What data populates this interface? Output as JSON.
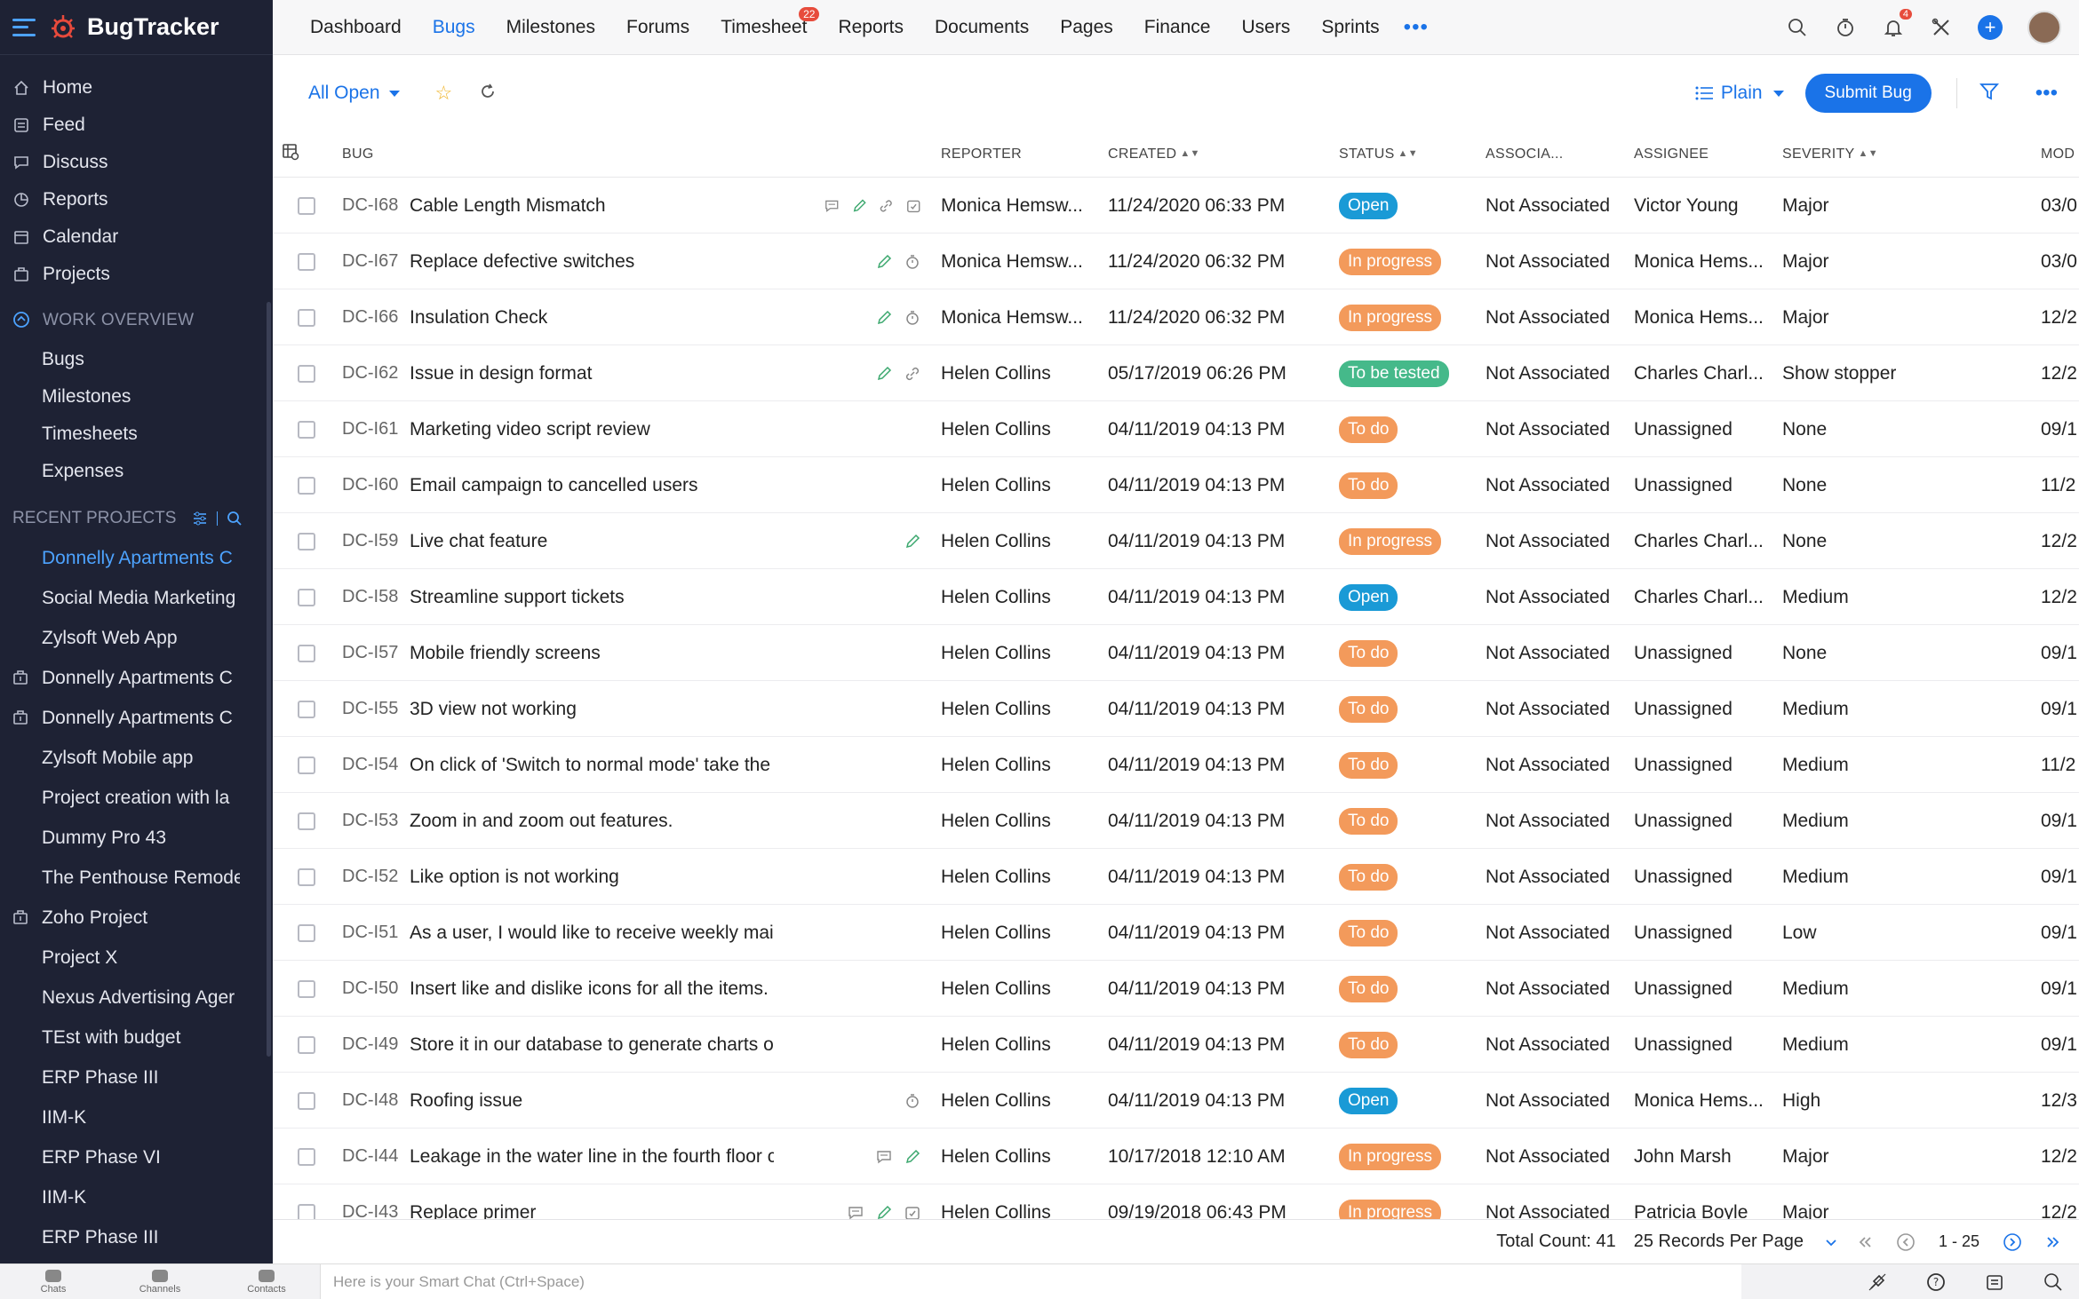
{
  "app": {
    "name": "BugTracker"
  },
  "sidebar": {
    "nav": [
      {
        "label": "Home",
        "icon": "home-icon"
      },
      {
        "label": "Feed",
        "icon": "feed-icon"
      },
      {
        "label": "Discuss",
        "icon": "discuss-icon"
      },
      {
        "label": "Reports",
        "icon": "reports-icon"
      },
      {
        "label": "Calendar",
        "icon": "calendar-icon"
      },
      {
        "label": "Projects",
        "icon": "projects-icon"
      }
    ],
    "work_overview": {
      "title": "WORK OVERVIEW",
      "items": [
        "Bugs",
        "Milestones",
        "Timesheets",
        "Expenses"
      ]
    },
    "recent_projects": {
      "title": "RECENT PROJECTS",
      "items": [
        {
          "label": "Donnelly Apartments C",
          "active": true,
          "icon": false
        },
        {
          "label": "Social Media Marketing",
          "active": false,
          "icon": false
        },
        {
          "label": "Zylsoft Web App",
          "active": false,
          "icon": false
        },
        {
          "label": "Donnelly Apartments C",
          "active": false,
          "icon": true
        },
        {
          "label": "Donnelly Apartments C",
          "active": false,
          "icon": true
        },
        {
          "label": "Zylsoft Mobile app",
          "active": false,
          "icon": false
        },
        {
          "label": "Project creation with la",
          "active": false,
          "icon": false
        },
        {
          "label": "Dummy Pro 43",
          "active": false,
          "icon": false
        },
        {
          "label": "The Penthouse Remode",
          "active": false,
          "icon": false
        },
        {
          "label": "Zoho Project",
          "active": false,
          "icon": true
        },
        {
          "label": "Project X",
          "active": false,
          "icon": false
        },
        {
          "label": "Nexus Advertising Ager",
          "active": false,
          "icon": false
        },
        {
          "label": "TEst with budget",
          "active": false,
          "icon": false
        },
        {
          "label": "ERP Phase III",
          "active": false,
          "icon": false
        },
        {
          "label": "IIM-K",
          "active": false,
          "icon": false
        },
        {
          "label": "ERP Phase VI",
          "active": false,
          "icon": false
        },
        {
          "label": "IIM-K",
          "active": false,
          "icon": false
        },
        {
          "label": "ERP Phase III",
          "active": false,
          "icon": false
        }
      ]
    }
  },
  "topnav": {
    "tabs": [
      {
        "label": "Dashboard",
        "active": false
      },
      {
        "label": "Bugs",
        "active": true
      },
      {
        "label": "Milestones",
        "active": false
      },
      {
        "label": "Forums",
        "active": false
      },
      {
        "label": "Timesheet",
        "active": false,
        "badge": "22"
      },
      {
        "label": "Reports",
        "active": false
      },
      {
        "label": "Documents",
        "active": false
      },
      {
        "label": "Pages",
        "active": false
      },
      {
        "label": "Finance",
        "active": false
      },
      {
        "label": "Users",
        "active": false
      },
      {
        "label": "Sprints",
        "active": false
      }
    ],
    "more": "•••",
    "notification_count": "4"
  },
  "toolbar": {
    "view": "All Open",
    "layout": "Plain",
    "submit_label": "Submit Bug"
  },
  "table": {
    "headers": {
      "bug": "BUG",
      "reporter": "REPORTER",
      "created": "CREATED",
      "status": "STATUS",
      "associated": "ASSOCIA...",
      "assignee": "ASSIGNEE",
      "severity": "SEVERITY",
      "modified": "MOD"
    },
    "rows": [
      {
        "id": "DC-I68",
        "title": "Cable Length Mismatch",
        "icons": [
          "comment-icon",
          "edit-icon",
          "link-icon",
          "task-icon"
        ],
        "reporter": "Monica Hemsw...",
        "created": "11/24/2020 06:33 PM",
        "status": "Open",
        "status_type": "open",
        "associated": "Not Associated",
        "assignee": "Victor Young",
        "severity": "Major",
        "modified": "03/0"
      },
      {
        "id": "DC-I67",
        "title": "Replace defective switches",
        "icons": [
          "edit-icon",
          "timer-icon"
        ],
        "reporter": "Monica Hemsw...",
        "created": "11/24/2020 06:32 PM",
        "status": "In progress",
        "status_type": "progress",
        "associated": "Not Associated",
        "assignee": "Monica Hems...",
        "severity": "Major",
        "modified": "03/0"
      },
      {
        "id": "DC-I66",
        "title": "Insulation Check",
        "icons": [
          "edit-icon",
          "timer-icon"
        ],
        "reporter": "Monica Hemsw...",
        "created": "11/24/2020 06:32 PM",
        "status": "In progress",
        "status_type": "progress",
        "associated": "Not Associated",
        "assignee": "Monica Hems...",
        "severity": "Major",
        "modified": "12/2"
      },
      {
        "id": "DC-I62",
        "title": "Issue in design format",
        "icons": [
          "edit-icon",
          "link-icon"
        ],
        "reporter": "Helen Collins",
        "created": "05/17/2019 06:26 PM",
        "status": "To be tested",
        "status_type": "tested",
        "associated": "Not Associated",
        "assignee": "Charles Charl...",
        "severity": "Show stopper",
        "modified": "12/2"
      },
      {
        "id": "DC-I61",
        "title": "Marketing video script review",
        "icons": [],
        "reporter": "Helen Collins",
        "created": "04/11/2019 04:13 PM",
        "status": "To do",
        "status_type": "todo",
        "associated": "Not Associated",
        "assignee": "Unassigned",
        "severity": "None",
        "modified": "09/1"
      },
      {
        "id": "DC-I60",
        "title": "Email campaign to cancelled users",
        "icons": [],
        "reporter": "Helen Collins",
        "created": "04/11/2019 04:13 PM",
        "status": "To do",
        "status_type": "todo",
        "associated": "Not Associated",
        "assignee": "Unassigned",
        "severity": "None",
        "modified": "11/2"
      },
      {
        "id": "DC-I59",
        "title": "Live chat feature",
        "icons": [
          "edit-icon"
        ],
        "reporter": "Helen Collins",
        "created": "04/11/2019 04:13 PM",
        "status": "In progress",
        "status_type": "progress",
        "associated": "Not Associated",
        "assignee": "Charles Charl...",
        "severity": "None",
        "modified": "12/2"
      },
      {
        "id": "DC-I58",
        "title": "Streamline support tickets",
        "icons": [],
        "reporter": "Helen Collins",
        "created": "04/11/2019 04:13 PM",
        "status": "Open",
        "status_type": "open",
        "associated": "Not Associated",
        "assignee": "Charles Charl...",
        "severity": "Medium",
        "modified": "12/2"
      },
      {
        "id": "DC-I57",
        "title": "Mobile friendly screens",
        "icons": [],
        "reporter": "Helen Collins",
        "created": "04/11/2019 04:13 PM",
        "status": "To do",
        "status_type": "todo",
        "associated": "Not Associated",
        "assignee": "Unassigned",
        "severity": "None",
        "modified": "09/1"
      },
      {
        "id": "DC-I55",
        "title": "3D view not working",
        "icons": [],
        "reporter": "Helen Collins",
        "created": "04/11/2019 04:13 PM",
        "status": "To do",
        "status_type": "todo",
        "associated": "Not Associated",
        "assignee": "Unassigned",
        "severity": "Medium",
        "modified": "09/1"
      },
      {
        "id": "DC-I54",
        "title": "On click of 'Switch to normal mode' take the",
        "icons": [],
        "reporter": "Helen Collins",
        "created": "04/11/2019 04:13 PM",
        "status": "To do",
        "status_type": "todo",
        "associated": "Not Associated",
        "assignee": "Unassigned",
        "severity": "Medium",
        "modified": "11/2"
      },
      {
        "id": "DC-I53",
        "title": "Zoom in and zoom out features.",
        "icons": [],
        "reporter": "Helen Collins",
        "created": "04/11/2019 04:13 PM",
        "status": "To do",
        "status_type": "todo",
        "associated": "Not Associated",
        "assignee": "Unassigned",
        "severity": "Medium",
        "modified": "09/1"
      },
      {
        "id": "DC-I52",
        "title": "Like option is not working",
        "icons": [],
        "reporter": "Helen Collins",
        "created": "04/11/2019 04:13 PM",
        "status": "To do",
        "status_type": "todo",
        "associated": "Not Associated",
        "assignee": "Unassigned",
        "severity": "Medium",
        "modified": "09/1"
      },
      {
        "id": "DC-I51",
        "title": "As a user, I would like to receive weekly mail",
        "icons": [],
        "reporter": "Helen Collins",
        "created": "04/11/2019 04:13 PM",
        "status": "To do",
        "status_type": "todo",
        "associated": "Not Associated",
        "assignee": "Unassigned",
        "severity": "Low",
        "modified": "09/1"
      },
      {
        "id": "DC-I50",
        "title": "Insert like and dislike icons for all the items.",
        "icons": [],
        "reporter": "Helen Collins",
        "created": "04/11/2019 04:13 PM",
        "status": "To do",
        "status_type": "todo",
        "associated": "Not Associated",
        "assignee": "Unassigned",
        "severity": "Medium",
        "modified": "09/1"
      },
      {
        "id": "DC-I49",
        "title": "Store it in our database to generate charts or",
        "icons": [],
        "reporter": "Helen Collins",
        "created": "04/11/2019 04:13 PM",
        "status": "To do",
        "status_type": "todo",
        "associated": "Not Associated",
        "assignee": "Unassigned",
        "severity": "Medium",
        "modified": "09/1"
      },
      {
        "id": "DC-I48",
        "title": "Roofing issue",
        "icons": [
          "timer-icon"
        ],
        "reporter": "Helen Collins",
        "created": "04/11/2019 04:13 PM",
        "status": "Open",
        "status_type": "open",
        "associated": "Not Associated",
        "assignee": "Monica Hems...",
        "severity": "High",
        "modified": "12/3"
      },
      {
        "id": "DC-I44",
        "title": "Leakage in the water line in the fourth floor c",
        "icons": [
          "comment-icon",
          "edit-icon"
        ],
        "reporter": "Helen Collins",
        "created": "10/17/2018 12:10 AM",
        "status": "In progress",
        "status_type": "progress",
        "associated": "Not Associated",
        "assignee": "John Marsh",
        "severity": "Major",
        "modified": "12/2"
      },
      {
        "id": "DC-I43",
        "title": "Replace primer",
        "icons": [
          "comment-icon",
          "edit-icon",
          "task-icon"
        ],
        "reporter": "Helen Collins",
        "created": "09/19/2018 06:43 PM",
        "status": "In progress",
        "status_type": "progress",
        "associated": "Not Associated",
        "assignee": "Patricia Boyle",
        "severity": "Major",
        "modified": "12/2"
      }
    ]
  },
  "footer": {
    "total_count": "Total Count: 41",
    "per_page": "25 Records Per Page",
    "range": "1 - 25"
  },
  "chatbar": {
    "tabs": [
      "Chats",
      "Channels",
      "Contacts"
    ],
    "placeholder": "Here is your Smart Chat (Ctrl+Space)"
  },
  "colors": {
    "accent": "#1a73e8",
    "sidebar_bg": "#1e2234",
    "status_open": "#1a9ad6",
    "status_progress": "#f39a5b",
    "status_tested": "#45b98a"
  }
}
